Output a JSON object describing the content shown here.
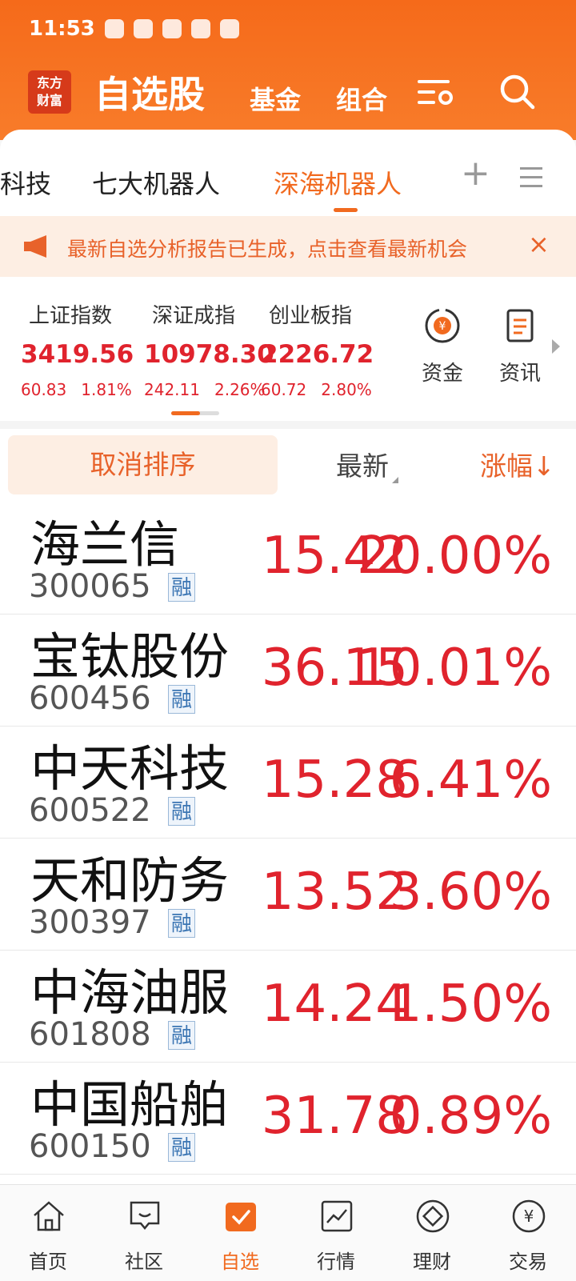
{
  "status_bar": {
    "time": "11:53"
  },
  "header": {
    "logo": "东方财富",
    "title": "自选股",
    "fund": "基金",
    "combo": "组合"
  },
  "tabs": [
    {
      "label": "科技",
      "active": false
    },
    {
      "label": "七大机器人",
      "active": false
    },
    {
      "label": "深海机器人",
      "active": true
    }
  ],
  "tab_plus": "+",
  "notice": {
    "text": "最新自选分析报告已生成，点击查看最新机会",
    "close": "×"
  },
  "indices": [
    {
      "name": "上证指数",
      "value": "3419.56",
      "change": "60.83",
      "percent": "1.81%"
    },
    {
      "name": "深证成指",
      "value": "10978.30",
      "change": "242.11",
      "percent": "2.26%"
    },
    {
      "name": "创业板指",
      "value": "2226.72",
      "change": "60.72",
      "percent": "2.80%"
    }
  ],
  "quick": {
    "funds": "资金",
    "news": "资讯"
  },
  "sort_bar": {
    "cancel": "取消排序",
    "latest": "最新",
    "change": "涨幅↓"
  },
  "stocks": [
    {
      "name": "海兰信",
      "code": "300065",
      "tag": "融",
      "price": "15.42",
      "change": "20.00%"
    },
    {
      "name": "宝钛股份",
      "code": "600456",
      "tag": "融",
      "price": "36.15",
      "change": "10.01%"
    },
    {
      "name": "中天科技",
      "code": "600522",
      "tag": "融",
      "price": "15.28",
      "change": "6.41%"
    },
    {
      "name": "天和防务",
      "code": "300397",
      "tag": "融",
      "price": "13.52",
      "change": "3.60%"
    },
    {
      "name": "中海油服",
      "code": "601808",
      "tag": "融",
      "price": "14.24",
      "change": "1.50%"
    },
    {
      "name": "中国船舶",
      "code": "600150",
      "tag": "融",
      "price": "31.78",
      "change": "0.89%"
    }
  ],
  "nav": [
    {
      "label": "首页",
      "icon": "home-icon"
    },
    {
      "label": "社区",
      "icon": "community-icon"
    },
    {
      "label": "自选",
      "icon": "watchlist-icon",
      "active": true
    },
    {
      "label": "行情",
      "icon": "market-icon"
    },
    {
      "label": "理财",
      "icon": "wealth-icon"
    },
    {
      "label": "交易",
      "icon": "trade-icon"
    }
  ],
  "colors": {
    "accent": "#f16a1f",
    "up": "#e0232d",
    "notice_bg": "#fdeee3"
  }
}
